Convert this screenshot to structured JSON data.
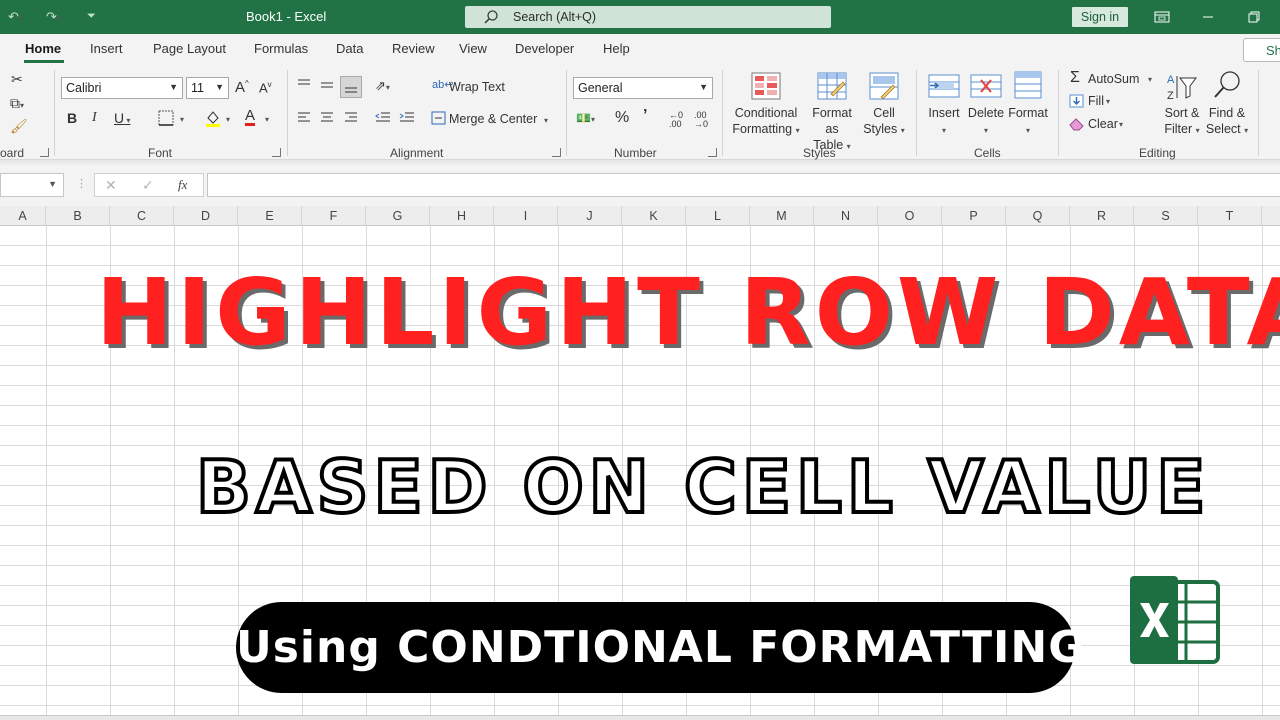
{
  "titlebar": {
    "doc_title": "Book1  -  Excel",
    "search_placeholder": "Search (Alt+Q)",
    "signin_label": "Sign in",
    "accent": "#217346"
  },
  "tabs": [
    {
      "label": "Home",
      "active": true
    },
    {
      "label": "Insert"
    },
    {
      "label": "Page Layout"
    },
    {
      "label": "Formulas"
    },
    {
      "label": "Data"
    },
    {
      "label": "Review"
    },
    {
      "label": "View"
    },
    {
      "label": "Developer"
    },
    {
      "label": "Help"
    }
  ],
  "share_label": "Sh",
  "ribbon": {
    "clipboard_label": "oard",
    "font": {
      "name": "Calibri",
      "size": "11",
      "group_label": "Font"
    },
    "alignment": {
      "wrap_text": "Wrap Text",
      "merge_center": "Merge & Center",
      "group_label": "Alignment"
    },
    "number": {
      "format": "General",
      "group_label": "Number"
    },
    "styles": {
      "conditional_1": "Conditional",
      "conditional_2": "Formatting",
      "format_as_1": "Format as",
      "format_as_2": "Table",
      "cell_styles_1": "Cell",
      "cell_styles_2": "Styles",
      "group_label": "Styles"
    },
    "cells": {
      "insert": "Insert",
      "delete": "Delete",
      "format": "Format",
      "group_label": "Cells"
    },
    "editing": {
      "autosum": "AutoSum",
      "fill": "Fill",
      "clear": "Clear",
      "sort_1": "Sort &",
      "sort_2": "Filter",
      "find_1": "Find &",
      "find_2": "Select",
      "group_label": "Editing"
    }
  },
  "formula_bar": {
    "fx": "fx"
  },
  "columns": [
    "A",
    "B",
    "C",
    "D",
    "E",
    "F",
    "G",
    "H",
    "I",
    "J",
    "K",
    "L",
    "M",
    "N",
    "O",
    "P",
    "Q",
    "R",
    "S",
    "T"
  ],
  "overlay": {
    "headline_1": "HIGHLIGHT ROW DATA",
    "headline_2": "BASED ON CELL VALUE",
    "pill_text": "Using CONDTIONAL FORMATTING",
    "headline_color": "#ff2020"
  }
}
